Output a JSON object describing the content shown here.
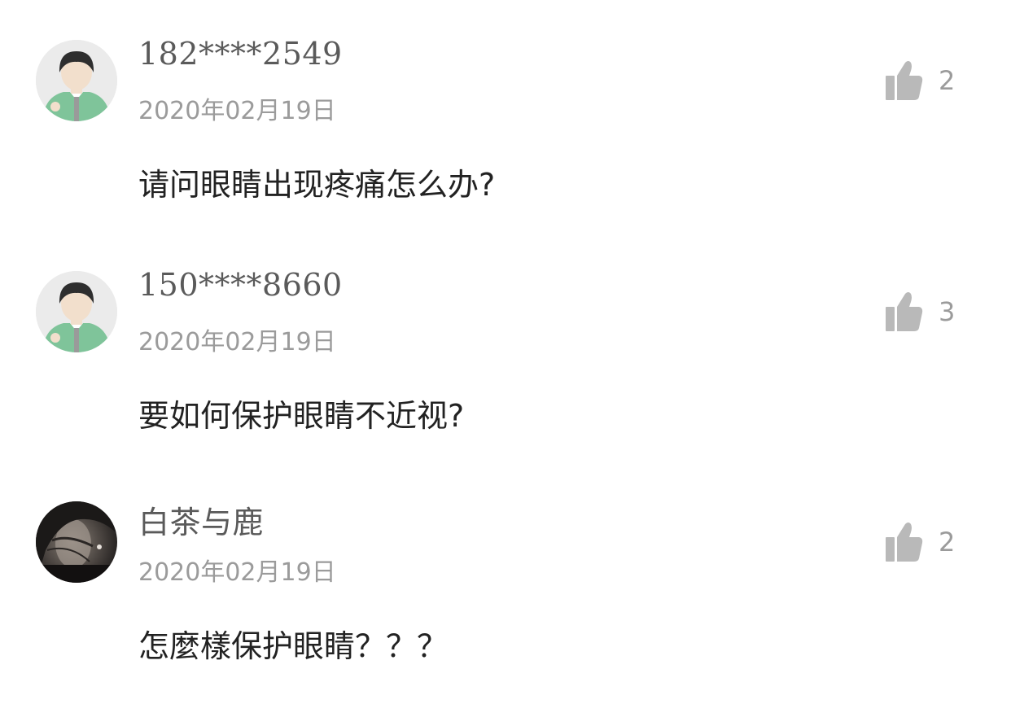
{
  "comments": [
    {
      "username": "182****2549",
      "date": "2020年02月19日",
      "text": "请问眼睛出现疼痛怎么办?",
      "likes": "2",
      "avatar": "cartoon-boy-icon"
    },
    {
      "username": "150****8660",
      "date": "2020年02月19日",
      "text": "要如何保护眼睛不近视?",
      "likes": "3",
      "avatar": "cartoon-boy-icon"
    },
    {
      "username": "白茶与鹿",
      "date": "2020年02月19日",
      "text": "怎麼樣保护眼睛？？？",
      "likes": "2",
      "avatar": "photo-avatar"
    }
  ],
  "colors": {
    "username": "#5a5a5a",
    "date": "#9b9b9b",
    "text": "#222222",
    "like_icon": "#b9b9b9"
  }
}
